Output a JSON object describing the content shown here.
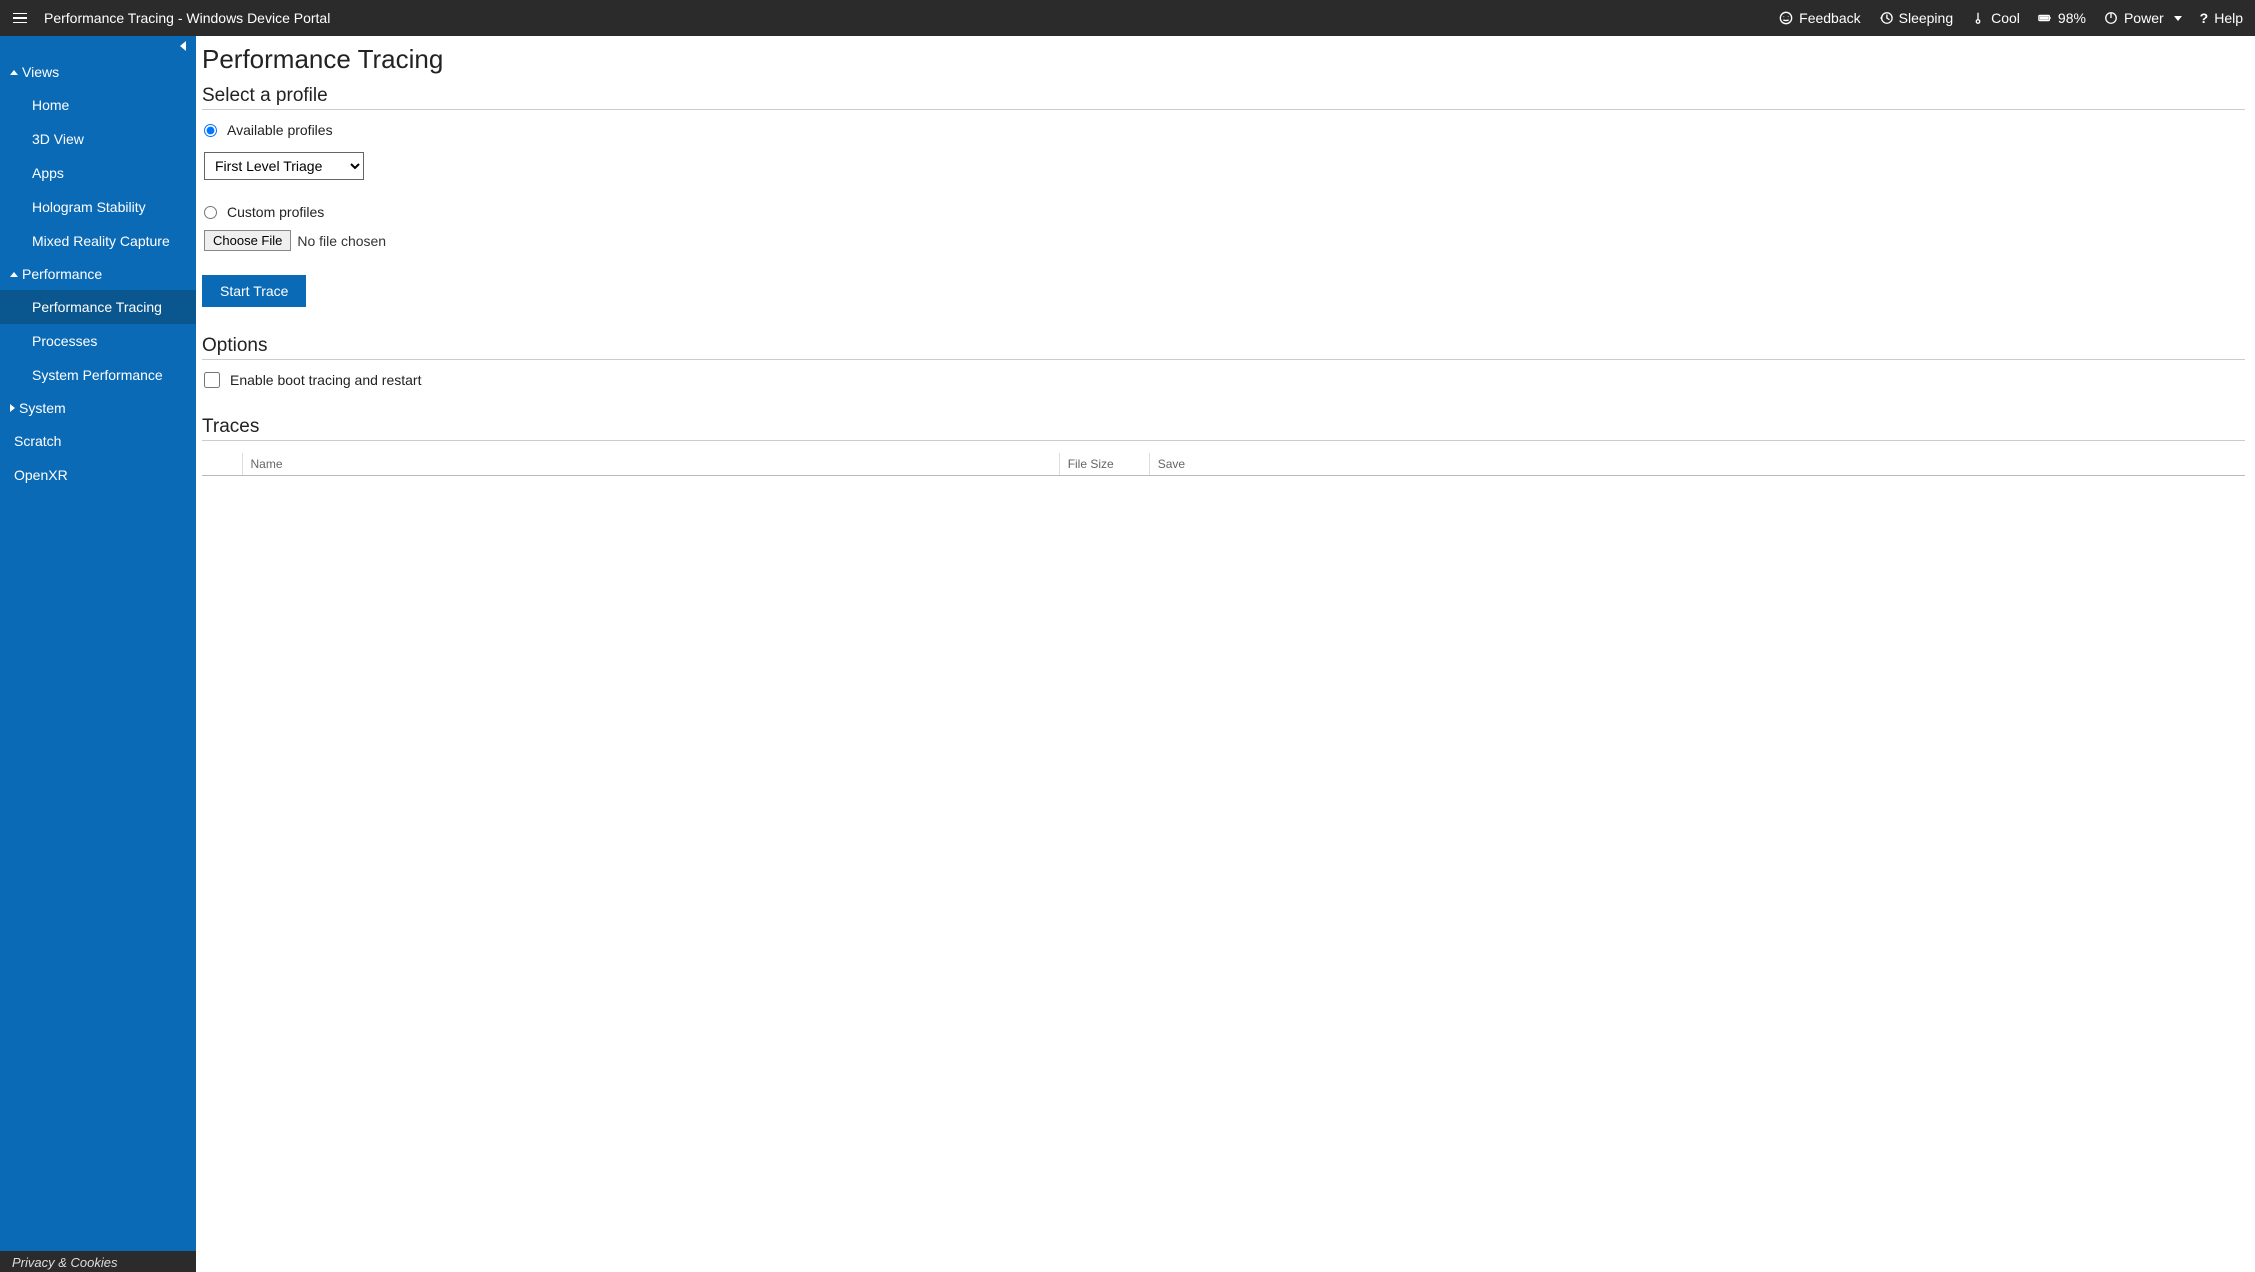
{
  "topbar": {
    "title": "Performance Tracing - Windows Device Portal",
    "feedback": "Feedback",
    "sleeping": "Sleeping",
    "cool": "Cool",
    "battery": "98%",
    "power": "Power",
    "help": "Help"
  },
  "sidebar": {
    "groups": [
      {
        "label": "Views",
        "expanded": true,
        "items": [
          {
            "label": "Home"
          },
          {
            "label": "3D View"
          },
          {
            "label": "Apps"
          },
          {
            "label": "Hologram Stability"
          },
          {
            "label": "Mixed Reality Capture"
          }
        ]
      },
      {
        "label": "Performance",
        "expanded": true,
        "items": [
          {
            "label": "Performance Tracing",
            "active": true
          },
          {
            "label": "Processes"
          },
          {
            "label": "System Performance"
          }
        ]
      },
      {
        "label": "System",
        "expanded": false,
        "items": []
      }
    ],
    "extras": [
      {
        "label": "Scratch"
      },
      {
        "label": "OpenXR"
      }
    ],
    "footer": "Privacy & Cookies"
  },
  "main": {
    "page_title": "Performance Tracing",
    "section_profile": "Select a profile",
    "radio_available": "Available profiles",
    "profile_options": [
      "First Level Triage"
    ],
    "profile_selected": "First Level Triage",
    "radio_custom": "Custom profiles",
    "choose_file_btn": "Choose File",
    "no_file": "No file chosen",
    "start_trace_btn": "Start Trace",
    "section_options": "Options",
    "boot_tracing_label": "Enable boot tracing and restart",
    "section_traces": "Traces",
    "traces_columns": {
      "name": "Name",
      "file_size": "File Size",
      "save": "Save"
    }
  }
}
